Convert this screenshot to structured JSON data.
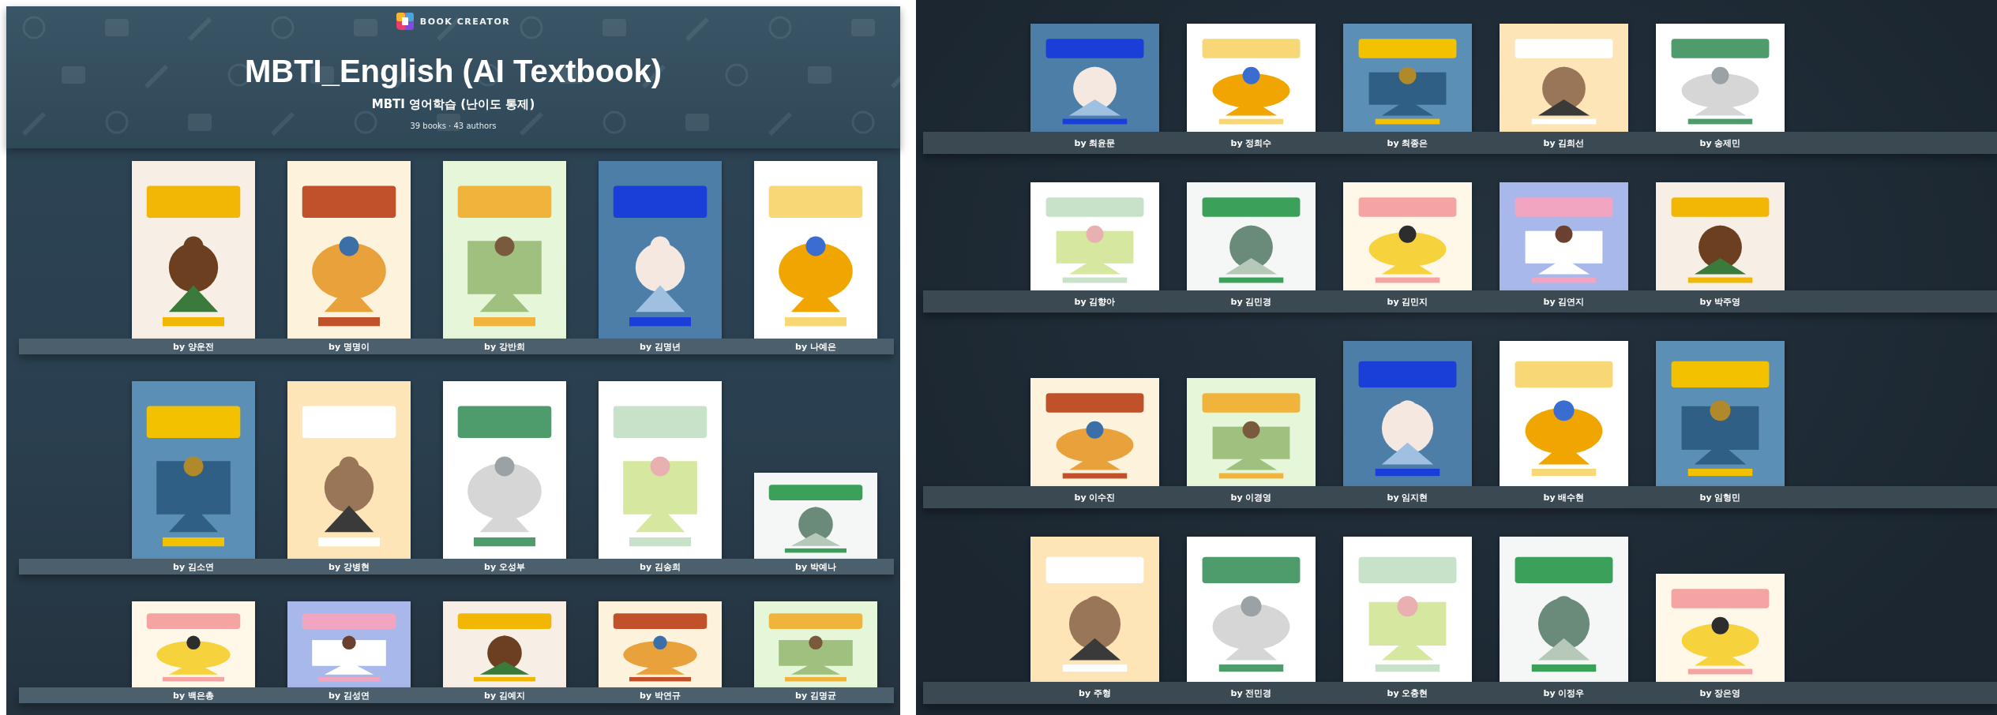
{
  "left_panel": {
    "header": {
      "brand": "BOOK CREATOR",
      "title": "MBTI_English (AI Textbook)",
      "subtitle": "MBTI 영어학습 (난이도 통제)",
      "stats": "39 books · 43 authors"
    },
    "shelves": [
      [
        {
          "kind": "portrait",
          "author": "by 양운전"
        },
        {
          "kind": "portrait",
          "author": "by 명명이"
        },
        {
          "kind": "portrait",
          "author": "by 강반희"
        },
        {
          "kind": "portrait",
          "author": "by 김명년"
        },
        {
          "kind": "portrait",
          "author": "by 나예은"
        }
      ],
      [
        {
          "kind": "portrait",
          "author": "by 김소연"
        },
        {
          "kind": "portrait",
          "author": "by 강병현"
        },
        {
          "kind": "portrait",
          "author": "by 오성부"
        },
        {
          "kind": "portrait",
          "author": "by 김송희"
        },
        {
          "kind": "wide",
          "author": "by 박예나"
        }
      ],
      [
        {
          "kind": "wide",
          "author": "by 백은총"
        },
        {
          "kind": "wide",
          "author": "by 김성연"
        },
        {
          "kind": "wide",
          "author": "by 김예지"
        },
        {
          "kind": "wide",
          "author": "by 박연규"
        },
        {
          "kind": "wide",
          "author": "by 김명균"
        }
      ]
    ]
  },
  "right_panel": {
    "shelves": [
      [
        {
          "kind": "square",
          "author": "by 최윤문"
        },
        {
          "kind": "square",
          "author": "by 정희수"
        },
        {
          "kind": "square",
          "author": "by 최종은"
        },
        {
          "kind": "square",
          "author": "by 김희선"
        },
        {
          "kind": "square",
          "author": "by 송제민"
        }
      ],
      [
        {
          "kind": "square",
          "author": "by 김향아"
        },
        {
          "kind": "square",
          "author": "by 김민경"
        },
        {
          "kind": "square",
          "author": "by 김민지"
        },
        {
          "kind": "square",
          "author": "by 김연지"
        },
        {
          "kind": "square",
          "author": "by 박주영"
        }
      ],
      [
        {
          "kind": "square",
          "author": "by 이수진"
        },
        {
          "kind": "square",
          "author": "by 이경영"
        },
        {
          "kind": "tall",
          "author": "by 임지현"
        },
        {
          "kind": "tall",
          "author": "by 배수현"
        },
        {
          "kind": "tall",
          "author": "by 임형민"
        }
      ],
      [
        {
          "kind": "tall",
          "author": "by 주형"
        },
        {
          "kind": "tall",
          "author": "by 전민경"
        },
        {
          "kind": "tall",
          "author": "by 오충현"
        },
        {
          "kind": "tall",
          "author": "by 이정우"
        },
        {
          "kind": "square",
          "author": "by 장은영"
        }
      ]
    ]
  }
}
